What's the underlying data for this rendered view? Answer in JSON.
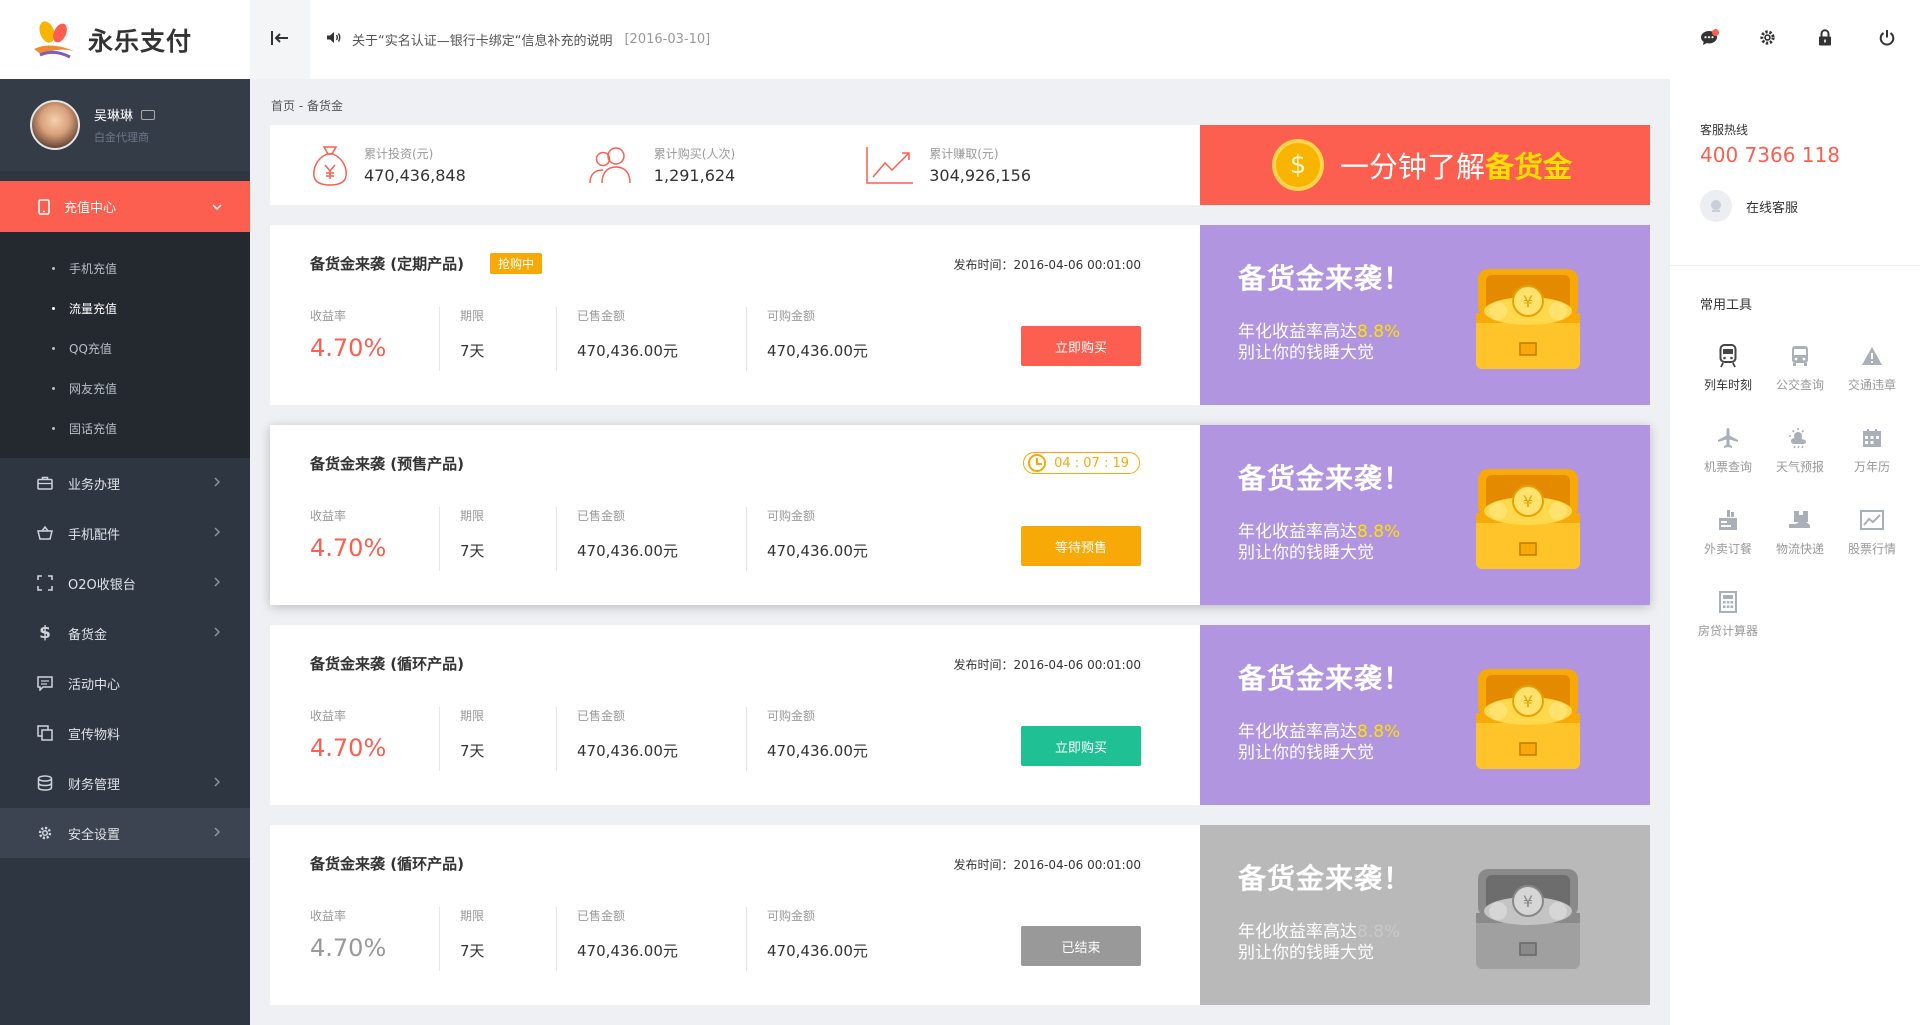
{
  "app": {
    "name": "永乐支付"
  },
  "colors": {
    "accent": "#fc5e4f",
    "orange": "#f7a907",
    "teal": "#1fc194",
    "purple": "#b195e0",
    "gray": "#999999",
    "sidebar": "#2e3642"
  },
  "user": {
    "name": "吴琳琳",
    "role": "白金代理商"
  },
  "sidebar": {
    "active": {
      "label": "充值中心",
      "icon": "phone-icon"
    },
    "submenu": [
      {
        "label": "手机充值"
      },
      {
        "label": "流量充值"
      },
      {
        "label": "QQ充值"
      },
      {
        "label": "网友充值"
      },
      {
        "label": "固话充值"
      }
    ],
    "items": [
      {
        "label": "业务办理",
        "icon": "briefcase-icon"
      },
      {
        "label": "手机配件",
        "icon": "basket-icon"
      },
      {
        "label": "O2O收银台",
        "icon": "scan-icon"
      },
      {
        "label": "备货金",
        "icon": "dollar-icon"
      },
      {
        "label": "活动中心",
        "icon": "message-icon"
      },
      {
        "label": "宣传物料",
        "icon": "copy-icon"
      },
      {
        "label": "财务管理",
        "icon": "database-icon"
      },
      {
        "label": "安全设置",
        "icon": "gear-icon"
      }
    ]
  },
  "topbar": {
    "notice_text": "关于“实名认证—银行卡绑定“信息补充的说明",
    "notice_date": "[2016-03-10]"
  },
  "breadcrumb": "首页 - 备货金",
  "stats": [
    {
      "label": "累计投资(元)",
      "value": "470,436,848",
      "icon": "money-bag-icon"
    },
    {
      "label": "累计购买(人次)",
      "value": "1,291,624",
      "icon": "users-icon"
    },
    {
      "label": "累计赚取(元)",
      "value": "304,926,156",
      "icon": "trend-chart-icon"
    }
  ],
  "promo": {
    "prefix": "一分钟了解",
    "highlight": "备货金",
    "coin": "$"
  },
  "product_cols": {
    "rate": "收益率",
    "term": "期限",
    "sold": "已售金额",
    "available": "可购金额"
  },
  "products": [
    {
      "title": "备货金来袭 (定期产品)",
      "tag": "抢购中",
      "time": "发布时间：2016-04-06 00:01:00",
      "rate": "4.70%",
      "term": "7天",
      "sold": "470,436.00元",
      "available": "470,436.00元",
      "button": "立即购买"
    },
    {
      "title": "备货金来袭 (预售产品)",
      "countdown": "04 : 07 : 19",
      "rate": "4.70%",
      "term": "7天",
      "sold": "470,436.00元",
      "available": "470,436.00元",
      "button": "等待预售"
    },
    {
      "title": "备货金来袭 (循环产品)",
      "time": "发布时间：2016-04-06 00:01:00",
      "rate": "4.70%",
      "term": "7天",
      "sold": "470,436.00元",
      "available": "470,436.00元",
      "button": "立即购买"
    },
    {
      "title": "备货金来袭 (循环产品)",
      "time": "发布时间：2016-04-06 00:01:00",
      "rate": "4.70%",
      "term": "7天",
      "sold": "470,436.00元",
      "available": "470,436.00元",
      "button": "已结束"
    }
  ],
  "banner": {
    "headline": "备货金来袭！",
    "line1_prefix": "年化收益率高达",
    "line1_rate": "8.8%",
    "line2": "别让你的钱睡大觉",
    "coin": "¥"
  },
  "right": {
    "hotline_label": "客服热线",
    "hotline": "400 7366 118",
    "online_service": "在线客服",
    "tools_label": "常用工具",
    "tools": [
      {
        "label": "列车时刻",
        "icon": "train-icon"
      },
      {
        "label": "公交查询",
        "icon": "bus-icon"
      },
      {
        "label": "交通违章",
        "icon": "warning-icon"
      },
      {
        "label": "机票查询",
        "icon": "airplane-icon"
      },
      {
        "label": "天气预报",
        "icon": "weather-icon"
      },
      {
        "label": "万年历",
        "icon": "calendar-icon"
      },
      {
        "label": "外卖订餐",
        "icon": "takeout-icon"
      },
      {
        "label": "物流快递",
        "icon": "delivery-icon"
      },
      {
        "label": "股票行情",
        "icon": "stock-icon"
      },
      {
        "label": "房贷计算器",
        "icon": "calculator-icon"
      }
    ]
  }
}
